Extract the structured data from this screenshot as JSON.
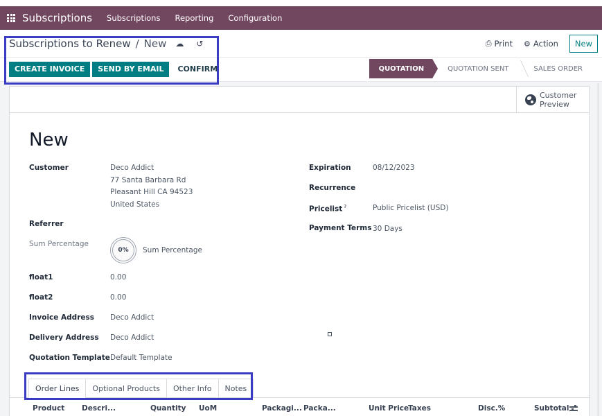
{
  "navbar": {
    "brand": "Subscriptions",
    "menu": [
      "Subscriptions",
      "Reporting",
      "Configuration"
    ]
  },
  "breadcrumb": {
    "parent": "Subscriptions to Renew",
    "separator": "/",
    "current": "New",
    "save_icon": "cloud-upload-icon",
    "discard_icon": "undo-icon"
  },
  "toolbar": {
    "print_label": "Print",
    "action_label": "Action",
    "new_label": "New"
  },
  "buttons": {
    "create_invoice": "CREATE INVOICE",
    "send_by_email": "SEND BY EMAIL",
    "confirm": "CONFIRM"
  },
  "status": {
    "stages": [
      "QUOTATION",
      "QUOTATION SENT",
      "SALES ORDER"
    ],
    "active": "QUOTATION",
    "active_color": "#71475f"
  },
  "sheet": {
    "customer_preview_line1": "Customer",
    "customer_preview_line2": "Preview",
    "title": "New"
  },
  "fields_left": {
    "customer_label": "Customer",
    "customer_name": "Deco Addict",
    "customer_address1": "77 Santa Barbara Rd",
    "customer_address2": "Pleasant Hill CA 94523",
    "customer_country": "United States",
    "referrer_label": "Referrer",
    "sum_percentage_label": "Sum Percentage",
    "sum_percentage_value": "0%",
    "sum_percentage_text": "Sum Percentage",
    "float1_label": "float1",
    "float1_value": "0.00",
    "float2_label": "float2",
    "float2_value": "0.00",
    "invoice_address_label": "Invoice Address",
    "invoice_address_value": "Deco Addict",
    "delivery_address_label": "Delivery Address",
    "delivery_address_value": "Deco Addict",
    "quotation_template_label": "Quotation Template",
    "quotation_template_value": "Default Template"
  },
  "fields_right": {
    "expiration_label": "Expiration",
    "expiration_value": "08/12/2023",
    "recurrence_label": "Recurrence",
    "recurrence_value": "",
    "pricelist_label": "Pricelist",
    "pricelist_help": "?",
    "pricelist_value": "Public Pricelist (USD)",
    "payment_terms_label": "Payment Terms",
    "payment_terms_value": "30 Days"
  },
  "tabs": [
    "Order Lines",
    "Optional Products",
    "Other Info",
    "Notes"
  ],
  "active_tab": "Order Lines",
  "order_lines": {
    "columns": [
      "Product",
      "Descri...",
      "Quantity",
      "UoM",
      "Packagi...",
      "Packa...",
      "Unit Price",
      "Taxes",
      "Disc.%",
      "Subtotal"
    ]
  },
  "colors": {
    "brand": "#71475f",
    "primary": "#017e84",
    "highlight": "#3a3dc4"
  }
}
